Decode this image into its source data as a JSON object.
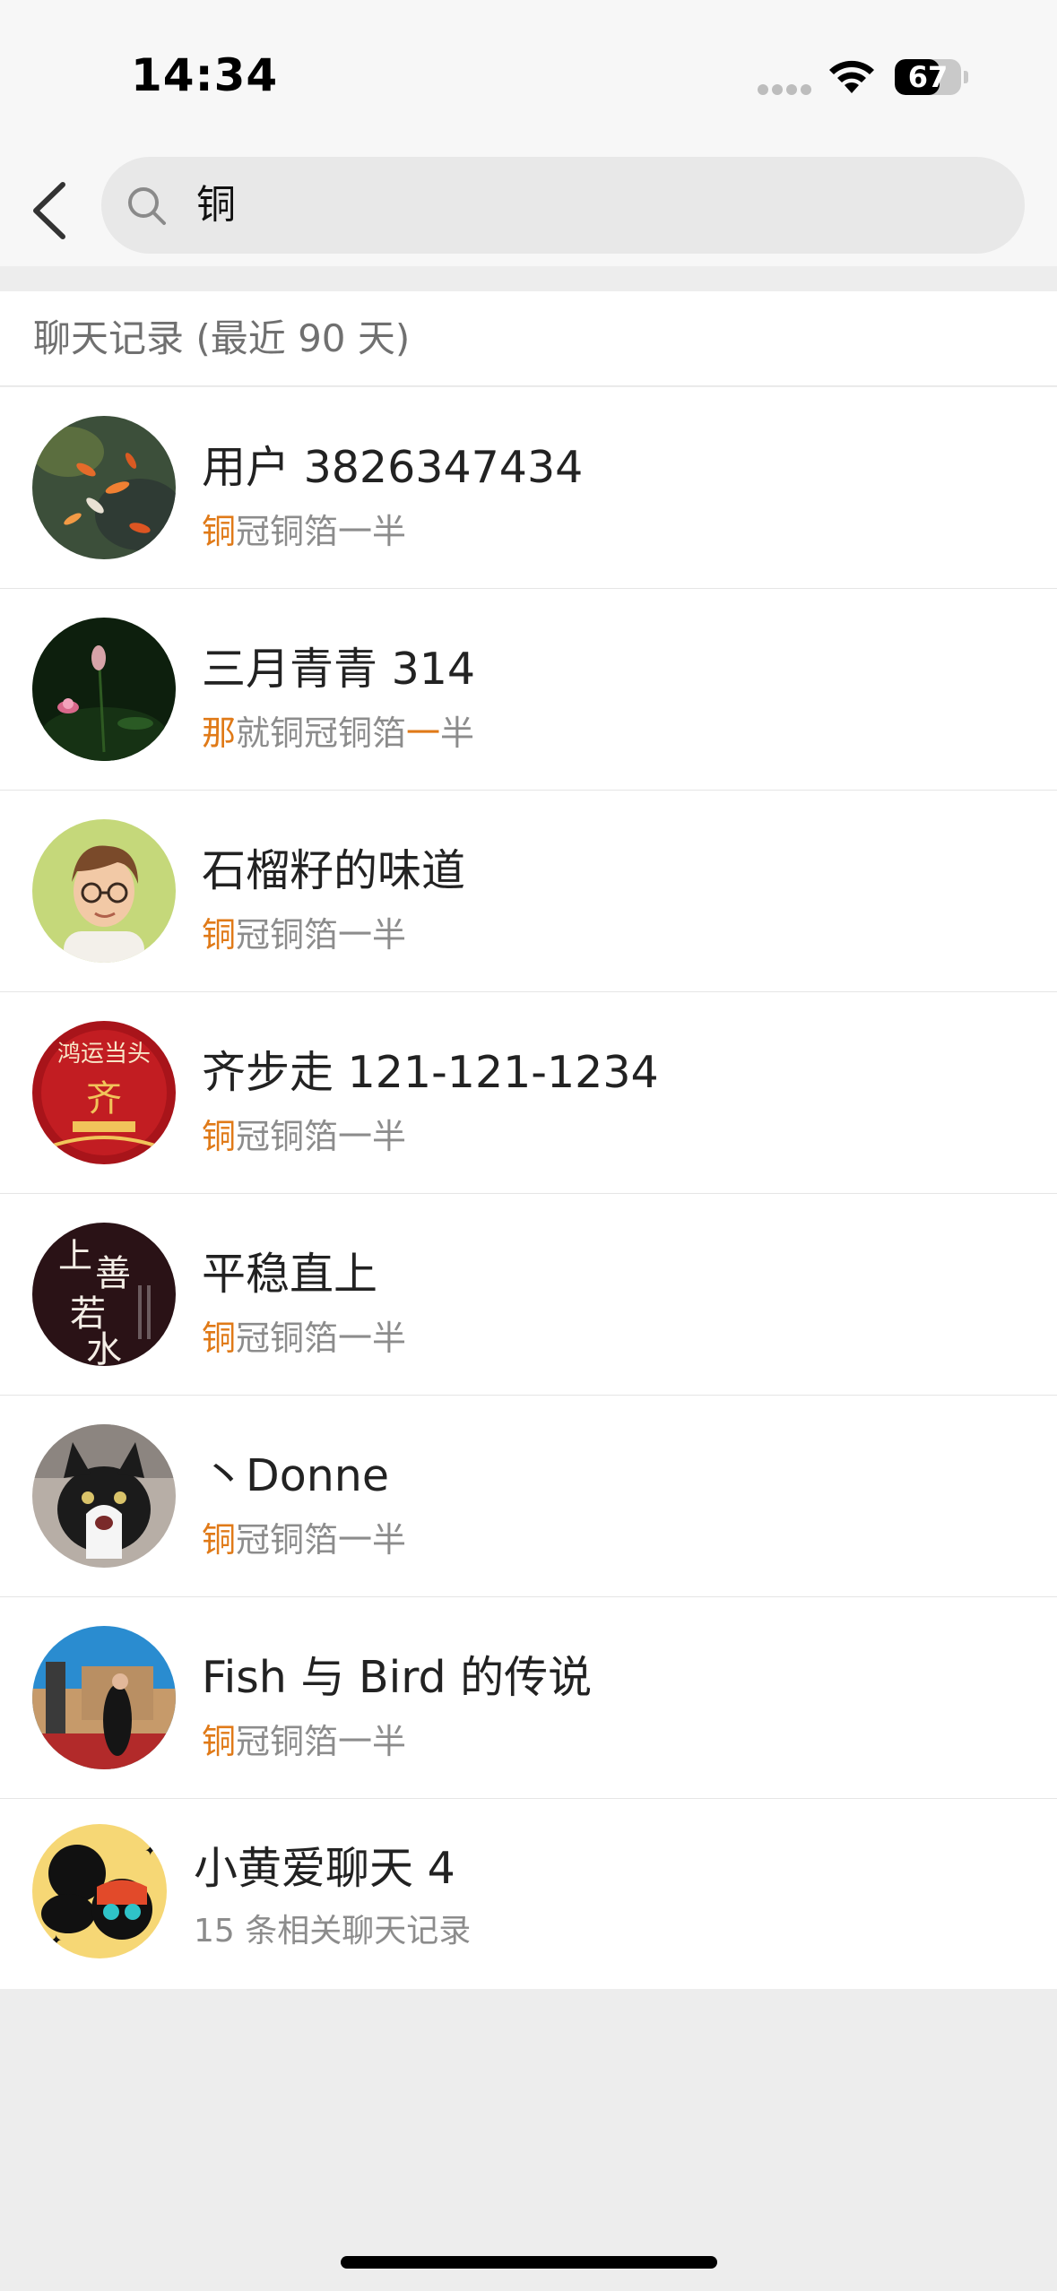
{
  "status_bar": {
    "time": "14:34",
    "battery": "67",
    "battery_level": 0.67
  },
  "search": {
    "query": "铜"
  },
  "section": {
    "title": "聊天记录 (最近 90 天)"
  },
  "results": [
    {
      "name": "用户 3826347434",
      "snippet_hl": "铜",
      "snippet_rest": "冠铜箔一半"
    },
    {
      "name": "三月青青 314",
      "snippet_hl": "那",
      "snippet_mid": "就铜冠铜箔",
      "snippet_hl2": "一",
      "snippet_rest": "半"
    },
    {
      "name": "石榴籽的味道",
      "snippet_hl": "铜",
      "snippet_rest": "冠铜箔一半"
    },
    {
      "name": "齐步走 121-121-1234",
      "snippet_hl": "铜",
      "snippet_rest": "冠铜箔一半",
      "avatar_text": "鸿运当头"
    },
    {
      "name": "平稳直上",
      "snippet_hl": "铜",
      "snippet_rest": "冠铜箔一半",
      "avatar_text": "上善若水"
    },
    {
      "name": "丶Donne",
      "snippet_hl": "铜",
      "snippet_rest": "冠铜箔一半"
    },
    {
      "name": "Fish 与 Bird 的传说",
      "snippet_hl": "铜",
      "snippet_rest": "冠铜箔一半"
    },
    {
      "name": "小黄爱聊天 4",
      "snippet": "15 条相关聊天记录"
    }
  ],
  "colors": {
    "highlight": "#e07a18",
    "background": "#ededed"
  }
}
